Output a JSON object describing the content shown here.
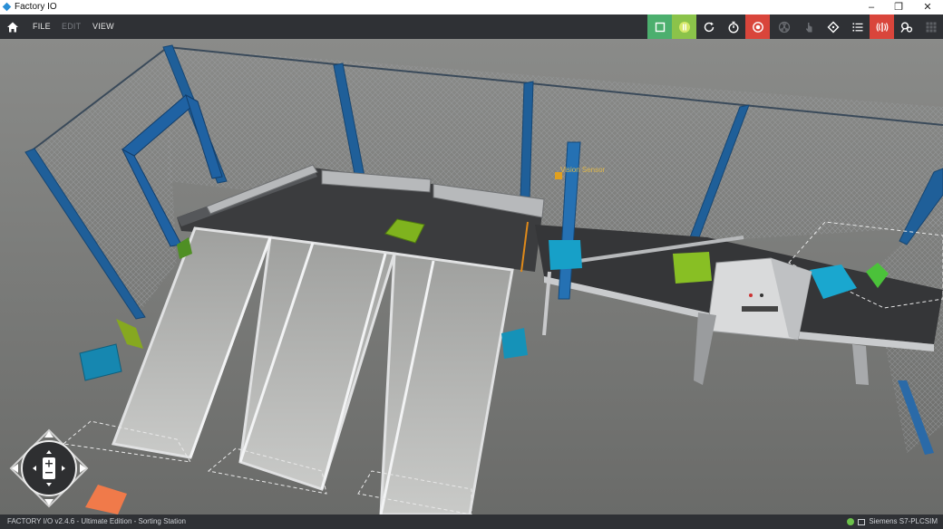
{
  "window": {
    "title": "Factory IO"
  },
  "menu": {
    "file": "FILE",
    "edit": "EDIT",
    "view": "VIEW"
  },
  "toolbar_icons": [
    "home-icon",
    "stop-icon",
    "pause-icon",
    "reset-icon",
    "timer-icon",
    "emergency-icon",
    "radiation-icon",
    "touch-icon",
    "diamond-icon",
    "list-icon",
    "sensor-signal-icon",
    "connections-icon",
    "grid-icon"
  ],
  "colors": {
    "stop_button": "#4caf6e",
    "pause_button": "#8bc34a",
    "alert_button": "#d9453b",
    "toolbar": "#2f3135"
  },
  "scene": {
    "sensor_label": "Vision Sensor"
  },
  "status": {
    "left": "FACTORY I/O v2.4.6 - Ultimate Edition - Sorting Station",
    "right": "Siemens S7-PLCSIM"
  }
}
